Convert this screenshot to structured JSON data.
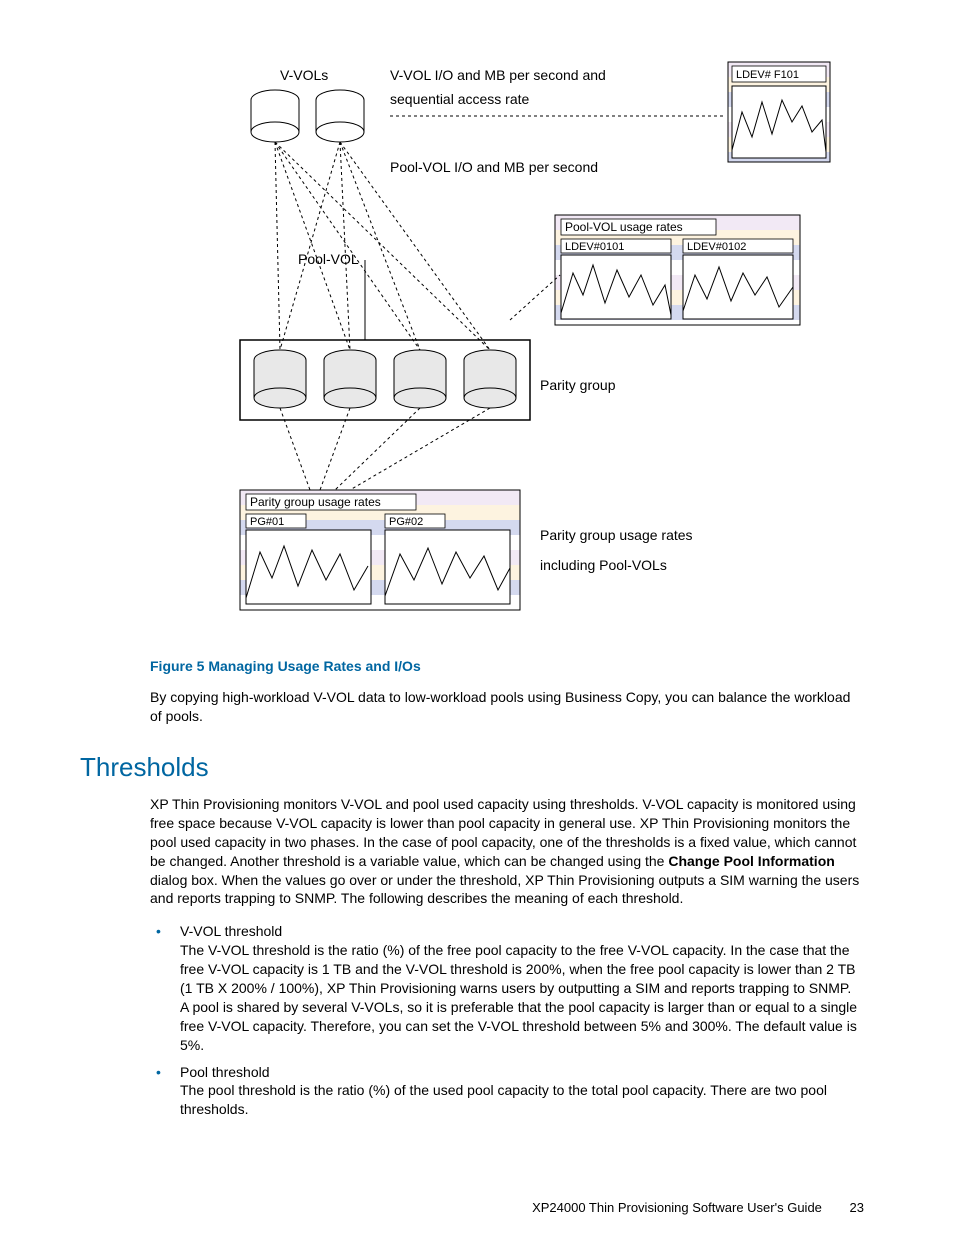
{
  "diagram": {
    "vvols_label": "V-VOLs",
    "vvol_io_label_line1": "V-VOL I/O and MB per second and",
    "vvol_io_label_line2": "sequential access rate",
    "poolvol_io_label": "Pool-VOL I/O and MB per second",
    "poolvol_label": "Pool-VOL",
    "parity_group_label": "Parity group",
    "ldev_f101": "LDEV# F101",
    "poolvol_usage_label": "Pool-VOL usage rates",
    "ldev_0101": "LDEV#0101",
    "ldev_0102": "LDEV#0102",
    "parity_usage_label": "Parity group usage rates",
    "pg01": "PG#01",
    "pg02": "PG#02",
    "parity_rates_text_line1": "Parity group usage rates",
    "parity_rates_text_line2": "including Pool-VOLs"
  },
  "figure_caption": "Figure 5 Managing Usage Rates and I/Os",
  "figure_description": "By copying high-workload V-VOL data to low-workload pools using Business Copy, you can balance the workload of pools.",
  "section_heading": "Thresholds",
  "thresholds_intro_before_bold": "XP Thin Provisioning monitors V-VOL and pool used capacity using thresholds. V-VOL capacity is monitored using free space because V-VOL capacity is lower than pool capacity in general use. XP Thin Provisioning monitors the pool used capacity in two phases. In the case of pool capacity, one of the thresholds is a fixed value, which cannot be changed. Another threshold is a variable value, which can be changed using the ",
  "thresholds_bold": "Change Pool Information",
  "thresholds_intro_after_bold": " dialog box. When the values go over or under the threshold, XP Thin Provisioning outputs a SIM warning the users and reports trapping to SNMP. The following describes the meaning of each threshold.",
  "bullets": [
    {
      "title": "V-VOL threshold",
      "body": "The V-VOL threshold is the ratio (%) of the free pool capacity to the free V-VOL capacity. In the case that the free V-VOL capacity is 1 TB and the V-VOL threshold is 200%, when the free pool capacity is lower than 2 TB (1 TB X 200% / 100%), XP Thin Provisioning warns users by outputting a SIM and reports trapping to SNMP.\nA pool is shared by several V-VOLs, so it is preferable that the pool capacity is larger than or equal to a single free V-VOL capacity. Therefore, you can set the V-VOL threshold between 5% and 300%. The default value is 5%."
    },
    {
      "title": "Pool threshold",
      "body": "The pool threshold is the ratio (%) of the used pool capacity to the total pool capacity. There are two pool thresholds."
    }
  ],
  "footer_title": "XP24000 Thin Provisioning Software User's Guide",
  "footer_page": "23"
}
